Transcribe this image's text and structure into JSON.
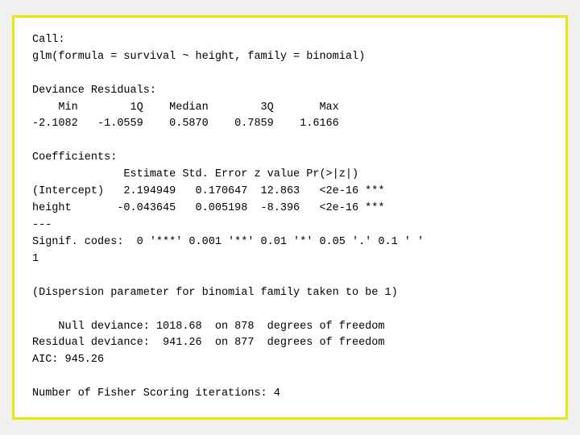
{
  "output": {
    "border_color": "#e8e800",
    "content": "Call:\nglm(formula = survival ~ height, family = binomial)\n\nDeviance Residuals:\n    Min        1Q    Median        3Q       Max\n-2.1082   -1.0559    0.5870    0.7859    1.6166\n\nCoefficients:\n              Estimate Std. Error z value Pr(>|z|)    \n(Intercept)   2.194949   0.170647  12.863   <2e-16 ***\nheight       -0.043645   0.005198  -8.396   <2e-16 ***\n---\nSignif. codes:  0 '***' 0.001 '**' 0.01 '*' 0.05 '.' 0.1 ' '\n1\n\n(Dispersion parameter for binomial family taken to be 1)\n\n    Null deviance: 1018.68  on 878  degrees of freedom\nResidual deviance:  941.26  on 877  degrees of freedom\nAIC: 945.26\n\nNumber of Fisher Scoring iterations: 4"
  }
}
